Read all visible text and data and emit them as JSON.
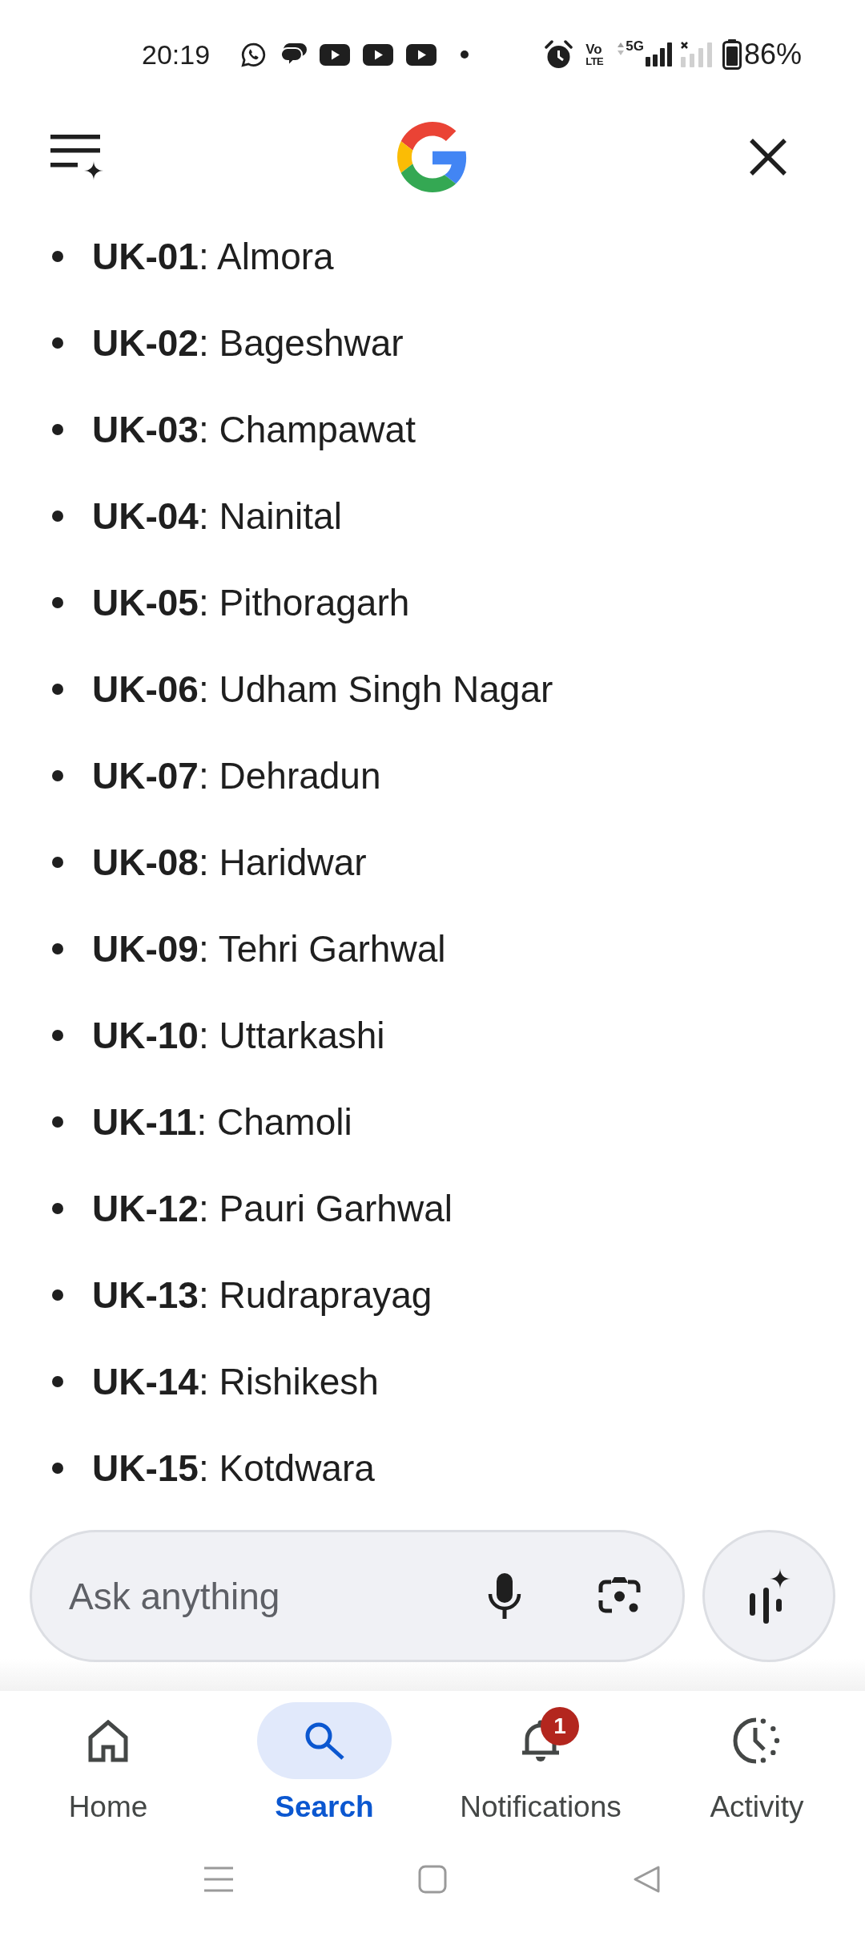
{
  "status_bar": {
    "time": "20:19",
    "volte_top": "Vo",
    "volte_bottom": "LTE",
    "network_type": "5G",
    "battery": "86%"
  },
  "list": {
    "items": [
      "**UK-01**: Almora",
      "**UK-02**: Bageshwar",
      "**UK-03**: Champawat",
      "**UK-04**: Nainital",
      "**UK-05**: Pithoragarh",
      "**UK-06**: Udham Singh Nagar",
      "**UK-07**: Dehradun",
      "**UK-08**: Haridwar",
      "**UK-09**: Tehri Garhwal",
      "**UK-10**: Uttarkashi",
      "**UK-11**: Chamoli",
      "**UK-12**: Pauri Garhwal",
      "**UK-13**: Rudraprayag",
      "**UK-14**: Rishikesh",
      "**UK-15**: Kotdwara"
    ]
  },
  "search_bar": {
    "placeholder": "Ask anything"
  },
  "bottom_nav": {
    "tabs": [
      {
        "label": "Home",
        "selected": false
      },
      {
        "label": "Search",
        "selected": true
      },
      {
        "label": "Notifications",
        "selected": false,
        "badge": "1"
      },
      {
        "label": "Activity",
        "selected": false
      }
    ]
  }
}
